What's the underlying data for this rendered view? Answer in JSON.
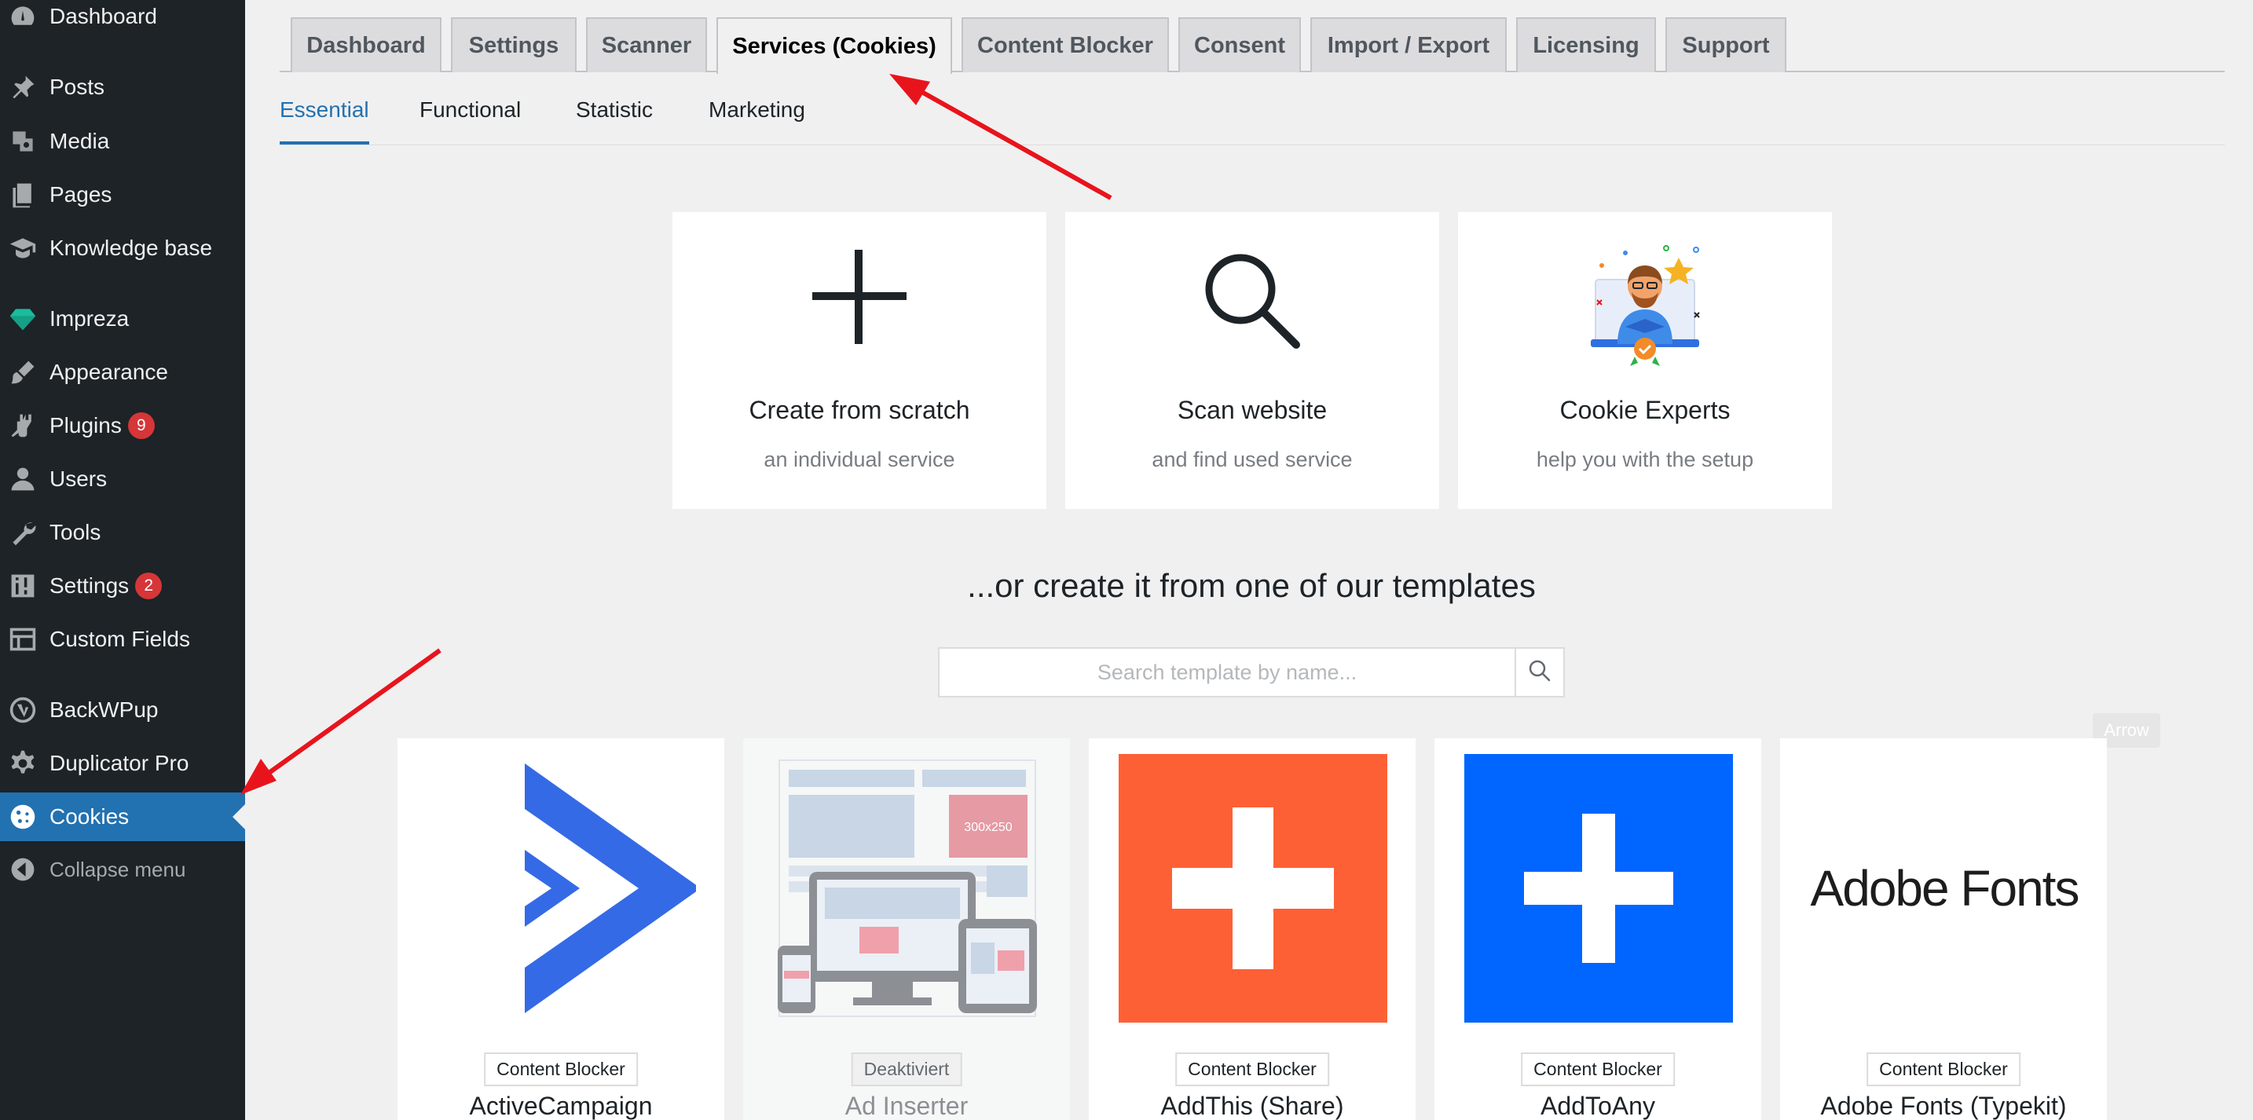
{
  "sidebar": {
    "items": [
      {
        "label": "Dashboard",
        "icon": "dashboard-icon"
      },
      {
        "label": "Posts",
        "icon": "pin-icon"
      },
      {
        "label": "Media",
        "icon": "media-icon"
      },
      {
        "label": "Pages",
        "icon": "pages-icon"
      },
      {
        "label": "Knowledge base",
        "icon": "graduation-cap-icon"
      },
      {
        "label": "Impreza",
        "icon": "diamond-icon"
      },
      {
        "label": "Appearance",
        "icon": "brush-icon"
      },
      {
        "label": "Plugins",
        "icon": "plug-icon",
        "badge": "9"
      },
      {
        "label": "Users",
        "icon": "user-icon"
      },
      {
        "label": "Tools",
        "icon": "wrench-icon"
      },
      {
        "label": "Settings",
        "icon": "sliders-icon",
        "badge": "2"
      },
      {
        "label": "Custom Fields",
        "icon": "table-icon"
      },
      {
        "label": "BackWPup",
        "icon": "backwpup-icon"
      },
      {
        "label": "Duplicator Pro",
        "icon": "gear-icon"
      },
      {
        "label": "Cookies",
        "icon": "cookie-icon",
        "active": true
      },
      {
        "label": "Collapse menu",
        "icon": "collapse-icon"
      }
    ]
  },
  "tabs": [
    "Dashboard",
    "Settings",
    "Scanner",
    "Services (Cookies)",
    "Content Blocker",
    "Consent",
    "Import / Export",
    "Licensing",
    "Support"
  ],
  "active_tab": "Services (Cookies)",
  "subtabs": [
    "Essential",
    "Functional",
    "Statistic",
    "Marketing"
  ],
  "active_subtab": "Essential",
  "options": [
    {
      "title": "Create from scratch",
      "subtitle": "an individual service",
      "icon": "plus-icon"
    },
    {
      "title": "Scan website",
      "subtitle": "and find used service",
      "icon": "magnifier-icon"
    },
    {
      "title": "Cookie Experts",
      "subtitle": "help you with the setup",
      "icon": "expert-illustration-icon"
    }
  ],
  "templates_heading": "...or create it from one of our templates",
  "search": {
    "placeholder": "Search template by name..."
  },
  "tooltip": "Arrow",
  "templates": [
    {
      "name": "ActiveCampaign",
      "badge": "Content Blocker",
      "logo": "activecampaign-logo"
    },
    {
      "name": "Ad Inserter",
      "badge": "Deaktiviert",
      "logo": "ad-inserter-logo",
      "disabled": true,
      "ad_size": "300x250"
    },
    {
      "name": "AddThis (Share)",
      "badge": "Content Blocker",
      "logo": "addthis-logo"
    },
    {
      "name": "AddToAny",
      "badge": "Content Blocker",
      "logo": "addtoany-logo"
    },
    {
      "name": "Adobe Fonts (Typekit)",
      "badge": "Content Blocker",
      "logo": "adobe-fonts-logo",
      "logo_text": "Adobe Fonts"
    }
  ],
  "colors": {
    "sidebar_bg": "#1d2327",
    "active_blue": "#2271b1",
    "badge_red": "#d63638",
    "addthis_orange": "#fe6036",
    "addtoany_blue": "#0166ff",
    "activecampaign_blue": "#356ae6",
    "arrow_red": "#e8141c"
  }
}
